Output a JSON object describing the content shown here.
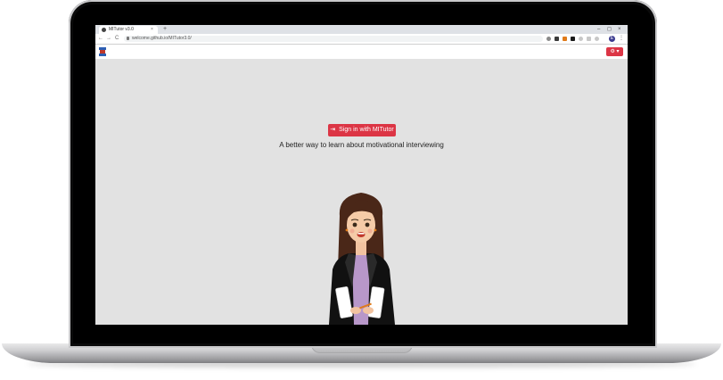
{
  "browser": {
    "tab_title": "MITutor v3.0",
    "tab_close": "×",
    "new_tab": "+",
    "url": "welcome.github.io/MITutor3.0/",
    "back": "←",
    "forward": "→",
    "reload": "C",
    "window_controls": {
      "minimize": "–",
      "maximize": "◻",
      "close": "×"
    },
    "profile_initial": "E",
    "menu": "⋮"
  },
  "app": {
    "settings_label": "⚙ ▾",
    "signin_icon": "⇥",
    "signin_label": "Sign in with MITutor",
    "tagline": "A better way to learn about motivational interviewing"
  },
  "colors": {
    "primary": "#dc3545",
    "background": "#e2e2e2"
  }
}
